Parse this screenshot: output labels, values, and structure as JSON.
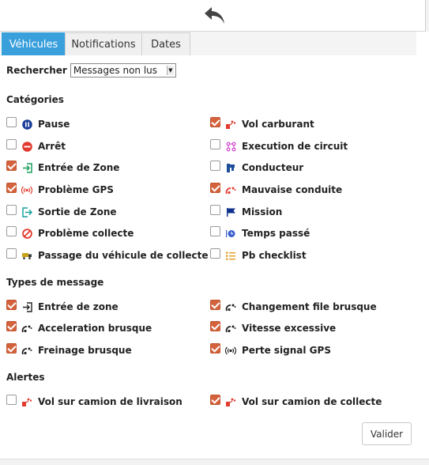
{
  "tabs": [
    {
      "label": "Véhicules",
      "active": true
    },
    {
      "label": "Notifications",
      "active": false
    },
    {
      "label": "Dates",
      "active": false
    }
  ],
  "search": {
    "label": "Rechercher",
    "selected": "Messages non lus"
  },
  "sections": {
    "categories": "Catégories",
    "types": "Types de message",
    "alertes": "Alertes"
  },
  "categories": [
    {
      "label": "Pause",
      "checked": false,
      "icon": "pause-circle-icon"
    },
    {
      "label": "Vol carburant",
      "checked": true,
      "icon": "fuel-theft-icon"
    },
    {
      "label": "Arrêt",
      "checked": false,
      "icon": "stop-sign-icon"
    },
    {
      "label": "Execution de circuit",
      "checked": false,
      "icon": "circuit-route-icon"
    },
    {
      "label": "Entrée de Zone",
      "checked": true,
      "icon": "zone-enter-icon"
    },
    {
      "label": "Conducteur",
      "checked": false,
      "icon": "driver-icon"
    },
    {
      "label": "Problème GPS",
      "checked": true,
      "icon": "gps-signal-icon"
    },
    {
      "label": "Mauvaise conduite",
      "checked": true,
      "icon": "bad-driving-icon"
    },
    {
      "label": "Sortie de Zone",
      "checked": false,
      "icon": "zone-exit-icon"
    },
    {
      "label": "Mission",
      "checked": false,
      "icon": "flag-icon"
    },
    {
      "label": "Problème collecte",
      "checked": false,
      "icon": "ban-icon"
    },
    {
      "label": "Temps passé",
      "checked": false,
      "icon": "time-spent-icon"
    },
    {
      "label": "Passage du véhicule de collecte",
      "checked": false,
      "icon": "collection-truck-icon"
    },
    {
      "label": "Pb checklist",
      "checked": false,
      "icon": "checklist-icon"
    }
  ],
  "types": [
    {
      "label": "Entrée de zone",
      "checked": true,
      "icon": "zone-enter-icon"
    },
    {
      "label": "Changement file brusque",
      "checked": true,
      "icon": "gauge-icon"
    },
    {
      "label": "Acceleration brusque",
      "checked": true,
      "icon": "gauge-icon"
    },
    {
      "label": "Vitesse excessive",
      "checked": true,
      "icon": "gauge-icon"
    },
    {
      "label": "Freinage brusque",
      "checked": true,
      "icon": "gauge-icon"
    },
    {
      "label": "Perte signal GPS",
      "checked": true,
      "icon": "gps-signal-icon"
    }
  ],
  "alertes": [
    {
      "label": "Vol sur camion de livraison",
      "checked": false,
      "icon": "fuel-theft-icon"
    },
    {
      "label": "Vol sur camion de collecte",
      "checked": true,
      "icon": "fuel-theft-icon"
    }
  ],
  "valider_label": "Valider",
  "colors": {
    "accent": "#3aa0dc",
    "checkbox": "#d4623c"
  }
}
